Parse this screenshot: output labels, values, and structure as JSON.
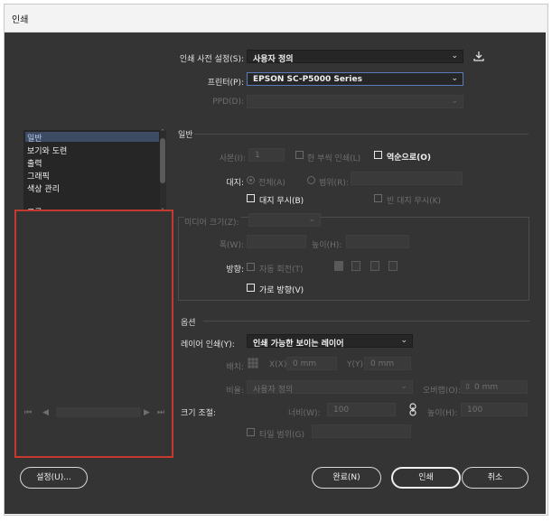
{
  "window": {
    "title": "인쇄"
  },
  "top": {
    "preset_label": "인쇄 사전 설정(S):",
    "preset_value": "사용자 정의",
    "printer_label": "프린터(P):",
    "printer_value": "EPSON SC-P5000 Series",
    "ppd_label": "PPD(D):",
    "ppd_value": ""
  },
  "sidebar": {
    "items": [
      {
        "label": "일반",
        "selected": true
      },
      {
        "label": "보기와 도련"
      },
      {
        "label": "출력"
      },
      {
        "label": "그래픽"
      },
      {
        "label": "색상 관리"
      },
      {
        "label": "고급"
      }
    ],
    "nav": {
      "first": "⏮",
      "prev": "◀",
      "next": "▶",
      "last": "⏭"
    }
  },
  "general": {
    "section_title": "일반",
    "copies_label": "사본(I):",
    "copies_value": "1",
    "collate_label": "한 부씩 인쇄(L)",
    "reverse_label": "역순으로(O)",
    "pages_label": "대지:",
    "all_label": "전체(A)",
    "range_label": "범위(R):",
    "range_value": "",
    "ignore_spreads_label": "대지 무시(B)",
    "print_blank_label": "빈 대지 무시(K)",
    "paper_size_label": "미디어 크기(Z):",
    "paper_size_value": "",
    "width_label": "폭(W):",
    "width_value": "",
    "height_label": "높이(H):",
    "height_value": "",
    "orientation_label": "방향:",
    "auto_rotate_label": "자동 회전(T)",
    "landscape_label": "가로 방향(V)"
  },
  "options": {
    "section_title": "옵션",
    "print_layers_label": "레이어 인쇄(Y):",
    "print_layers_value": "인쇄 가능한 보이는 레이어",
    "position_label": "배치:",
    "x_label": "X(X):",
    "x_value": "0 mm",
    "y_label": "Y(Y):",
    "y_value": "0 mm",
    "scale_label": "비율:",
    "scale_value": "사용자 정의",
    "overlap_label": "오버랩(O):",
    "overlap_value": "0 mm",
    "scale_adjust_label": "크기 조절:",
    "scale_w_label": "너비(W):",
    "scale_w_value": "100",
    "scale_h_label": "높이(H):",
    "scale_h_value": "100",
    "tile_label": "타일 범위(G)",
    "tile_value": ""
  },
  "buttons": {
    "setup": "설정(U)...",
    "done": "완료(N)",
    "print": "인쇄",
    "cancel": "취소"
  },
  "icons": {
    "save_preset": "save-preset-icon",
    "chain": "link-icon"
  },
  "colors": {
    "panel": "#343434",
    "highlight_border": "#c43a2e",
    "selected_item": "#3d4b63"
  }
}
